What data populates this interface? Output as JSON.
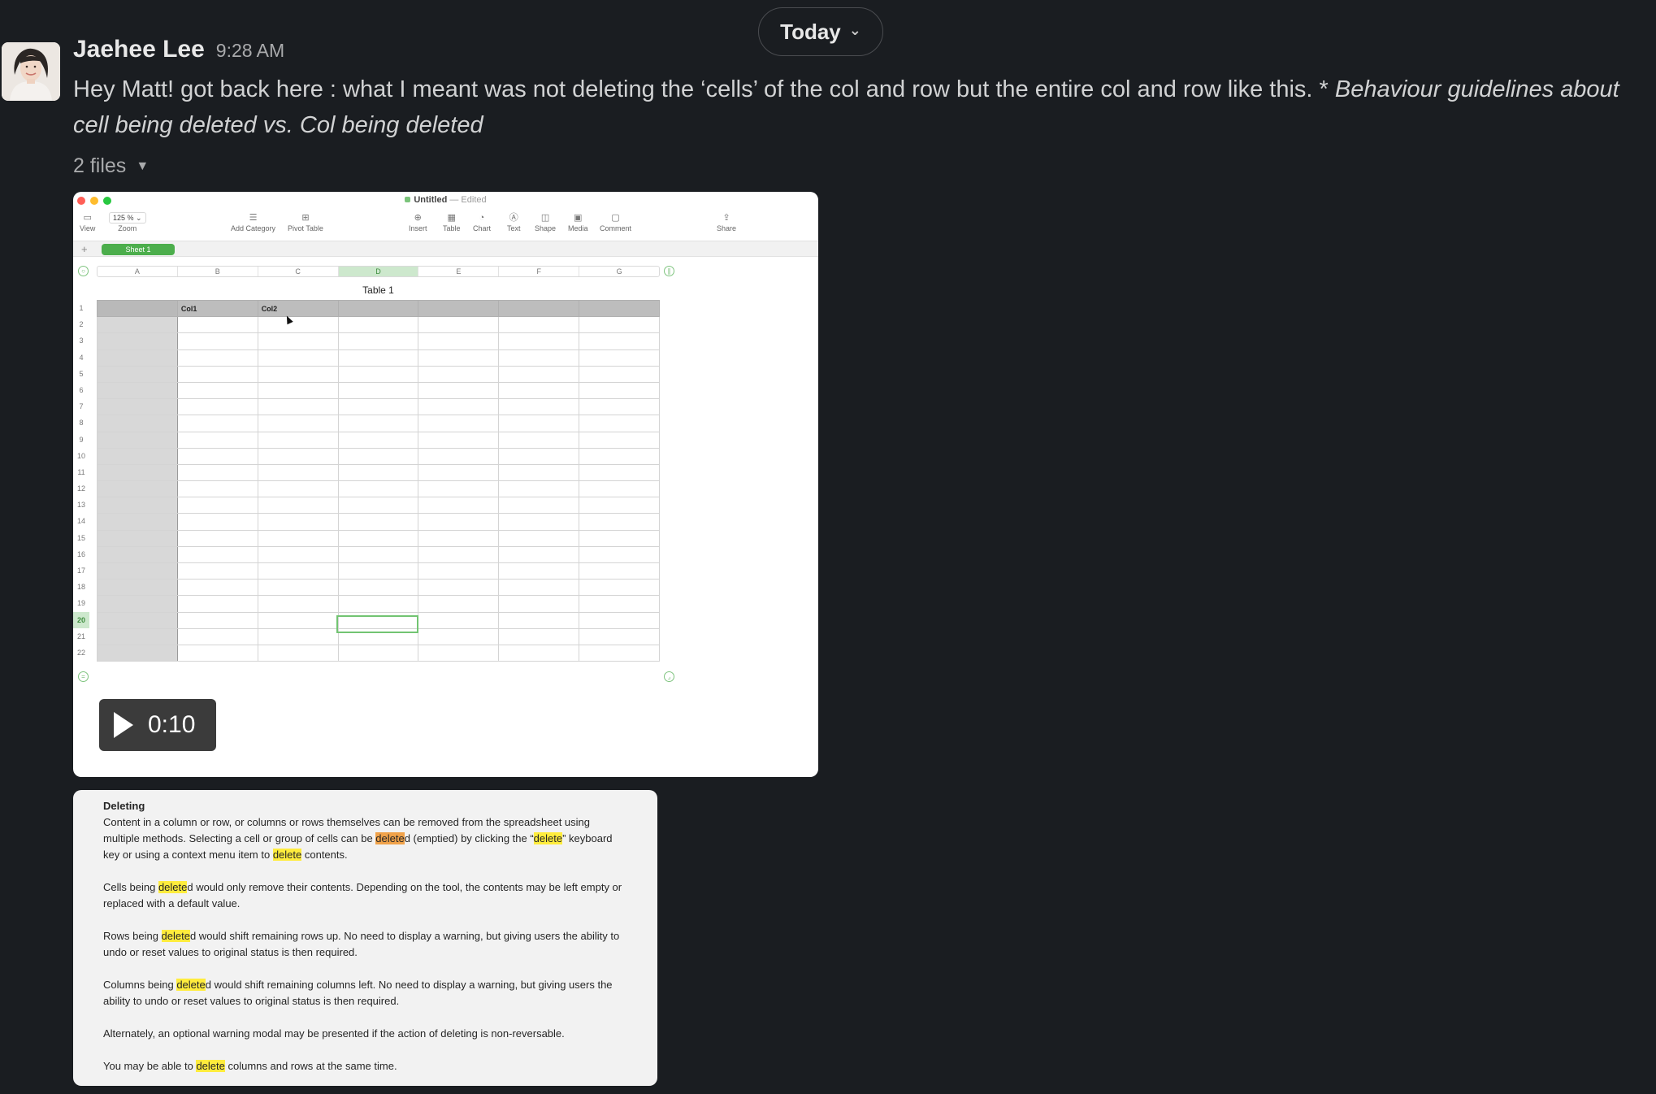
{
  "date_pill": {
    "label": "Today"
  },
  "message": {
    "sender": "Jaehee Lee",
    "time": "9:28 AM",
    "text_plain": "Hey Matt! got back here : what I meant was not deleting the ‘cells’ of the col and row but the entire col and row like this. * ",
    "text_italic": "Behaviour guidelines about cell being deleted vs. Col being deleted",
    "files_label": "2 files"
  },
  "numbers_app": {
    "doc_name": "Untitled",
    "doc_status": "— Edited",
    "toolbar": {
      "view": "View",
      "zoom_value": "125 %",
      "zoom": "Zoom",
      "add_category": "Add Category",
      "pivot_table": "Pivot Table",
      "insert": "Insert",
      "table": "Table",
      "chart": "Chart",
      "text": "Text",
      "shape": "Shape",
      "media": "Media",
      "comment": "Comment",
      "share": "Share"
    },
    "sheet_tab": "Sheet 1",
    "add_sheet": "+",
    "columns": [
      "A",
      "B",
      "C",
      "D",
      "E",
      "F",
      "G"
    ],
    "selected_column": "D",
    "table_title": "Table 1",
    "header_cells": [
      "",
      "Col1",
      "Col2",
      "",
      "",
      "",
      ""
    ],
    "row_numbers": [
      "1",
      "2",
      "3",
      "4",
      "5",
      "6",
      "7",
      "8",
      "9",
      "10",
      "11",
      "12",
      "13",
      "14",
      "15",
      "16",
      "17",
      "18",
      "19",
      "20",
      "21",
      "22"
    ],
    "selected_row": "20"
  },
  "video": {
    "duration": "0:10"
  },
  "doc_excerpt": {
    "heading": "Deleting",
    "p1_a": "Content in a column or row, or columns or rows themselves can be removed from the spreadsheet using multiple methods. Selecting a cell or group of cells can be ",
    "hl_delete": "delete",
    "p1_b": "d (emptied) by clicking the “",
    "p1_c": "” keyboard key or using a context menu item to ",
    "p1_d": " contents.",
    "p2_a": "Cells being ",
    "p2_b": "d would only remove their contents. Depending on the tool, the contents may be left empty or replaced with a default value.",
    "p3_a": "Rows being ",
    "p3_b": "d would shift remaining rows up. No need to display a warning, but giving users the ability to undo or reset values to original status is then required.",
    "p4_a": "Columns being ",
    "p4_b": "d would shift remaining columns left. No need to display a warning, but giving users the ability to undo or reset values to original status is then required.",
    "p5": "Alternately, an optional warning modal may be presented if the action of deleting is non-reversable.",
    "p6_a": "You may be able to ",
    "p6_b": " columns and rows at the same time."
  },
  "colors": {
    "background": "#1a1d21",
    "numbers_green": "#4cae4c",
    "highlight_yellow": "#ffec3d",
    "highlight_orange": "#f0a24a"
  }
}
